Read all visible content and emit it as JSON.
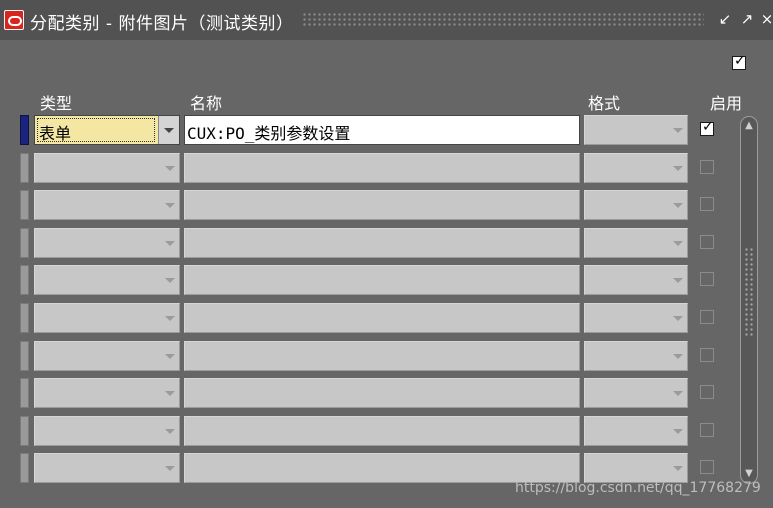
{
  "window": {
    "title": "分配类别 - 附件图片（测试类别）",
    "minimize_icon": "minimize-icon",
    "maximize_icon": "maximize-icon"
  },
  "columns": {
    "type": "类型",
    "name": "名称",
    "format": "格式",
    "enabled": "启用"
  },
  "outer_checkbox_checked": true,
  "rows": [
    {
      "type": "表单",
      "name": "CUX:PO_类别参数设置",
      "format": "",
      "enabled": true,
      "active": true
    },
    {
      "type": "",
      "name": "",
      "format": "",
      "enabled": false,
      "active": false
    },
    {
      "type": "",
      "name": "",
      "format": "",
      "enabled": false,
      "active": false
    },
    {
      "type": "",
      "name": "",
      "format": "",
      "enabled": false,
      "active": false
    },
    {
      "type": "",
      "name": "",
      "format": "",
      "enabled": false,
      "active": false
    },
    {
      "type": "",
      "name": "",
      "format": "",
      "enabled": false,
      "active": false
    },
    {
      "type": "",
      "name": "",
      "format": "",
      "enabled": false,
      "active": false
    },
    {
      "type": "",
      "name": "",
      "format": "",
      "enabled": false,
      "active": false
    },
    {
      "type": "",
      "name": "",
      "format": "",
      "enabled": false,
      "active": false
    },
    {
      "type": "",
      "name": "",
      "format": "",
      "enabled": false,
      "active": false
    }
  ],
  "watermark": "https://blog.csdn.net/qq_17768279",
  "colors": {
    "background": "#646464",
    "active_field": "#f3e7a3",
    "empty_field": "#c7c7c7",
    "row_indicator_active": "#1a237e"
  }
}
